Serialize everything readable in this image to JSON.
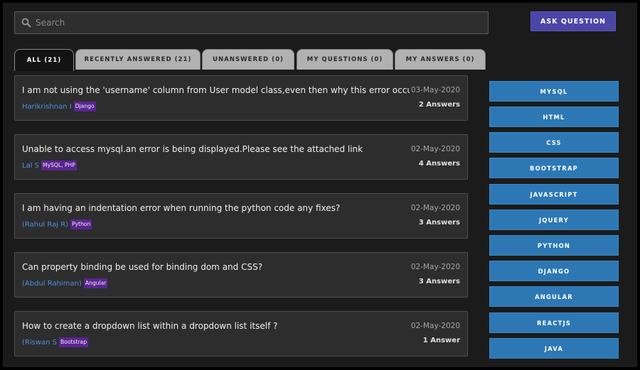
{
  "search": {
    "placeholder": "Search",
    "icon": "search-icon"
  },
  "ask_button": {
    "label": "ASK QUESTION",
    "color": "#4a45a6"
  },
  "tabs": [
    {
      "label": "ALL (21)",
      "active": true
    },
    {
      "label": "RECENTLY ANSWERED (21)",
      "active": false
    },
    {
      "label": "UNANSWERED (0)",
      "active": false
    },
    {
      "label": "MY QUESTIONS (0)",
      "active": false
    },
    {
      "label": "MY ANSWERS (0)",
      "active": false
    }
  ],
  "questions": [
    {
      "title": "I am not using the 'username' column from User model class,even then why this error occur ?",
      "author": "Harikrishnan I",
      "tag": "Django",
      "date": "03-May-2020",
      "answers": "2 Answers"
    },
    {
      "title": "Unable to access mysql.an error is being displayed.Please see the attached link",
      "author": "Lal S",
      "tag": "MySQL, PHP",
      "date": "02-May-2020",
      "answers": "4 Answers"
    },
    {
      "title": "I am having an indentation error when running the python code any fixes?",
      "author": "(Rahul Raj R)",
      "tag": "Python",
      "date": "02-May-2020",
      "answers": "3 Answers"
    },
    {
      "title": "Can property binding be used for binding dom and CSS?",
      "author": "(Abdul Rahiman)",
      "tag": "Angular",
      "date": "02-May-2020",
      "answers": "3 Answers"
    },
    {
      "title": "How to create a dropdown list within a dropdown list itself ?",
      "author": "(Riswan S",
      "tag": "Bootstrap",
      "date": "02-May-2020",
      "answers": "1 Answer"
    }
  ],
  "tag_filters": [
    "MYSQL",
    "HTML",
    "CSS",
    "BOOTSTRAP",
    "JAVASCRIPT",
    "JQUERY",
    "PYTHON",
    "DJANGO",
    "ANGULAR",
    "REACTJS",
    "JAVA"
  ],
  "colors": {
    "background": "#1b1b1b",
    "card": "#2d2d2d",
    "author_link": "#4f8fe0",
    "tag_badge": "#5b2491",
    "tag_button": "#2d78b4"
  }
}
